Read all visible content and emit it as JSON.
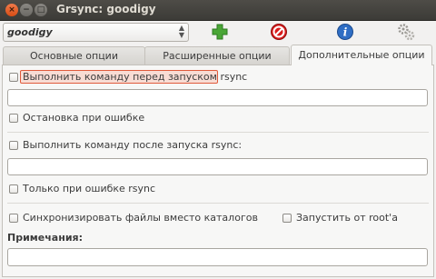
{
  "window": {
    "title": "Grsync: goodigy",
    "close_glyph": "×",
    "minimize_glyph": "−",
    "maximize_glyph": "□"
  },
  "toolbar": {
    "session_value": "goodigy",
    "combo_arrows": "⌃⌄",
    "icons": [
      "add-session-icon",
      "delete-session-icon",
      "info-icon",
      "execute-icon"
    ],
    "colors": {
      "add": "#4aa636",
      "delete": "#d81c1c",
      "info": "#2f6ec4"
    }
  },
  "tabs": [
    {
      "label": "Основные опции",
      "active": false
    },
    {
      "label": "Расширенные опции",
      "active": false
    },
    {
      "label": "Дополнительные опции",
      "active": true
    }
  ],
  "options": {
    "run_before_label": "Выполнить команду перед запуском rsync",
    "run_before_value": "",
    "stop_on_error_label": "Остановка при ошибке",
    "run_after_label": "Выполнить команду после запуска rsync:",
    "run_after_value": "",
    "only_on_error_label": "Только при ошибке rsync",
    "sync_files_label": "Синхронизировать файлы вместо каталогов",
    "run_as_root_label": "Запустить от root'а",
    "notes_label": "Примечания:",
    "notes_value": ""
  },
  "accent": {
    "focus_border": "#e05a3b",
    "focus_bg": "#f8dcd4"
  }
}
